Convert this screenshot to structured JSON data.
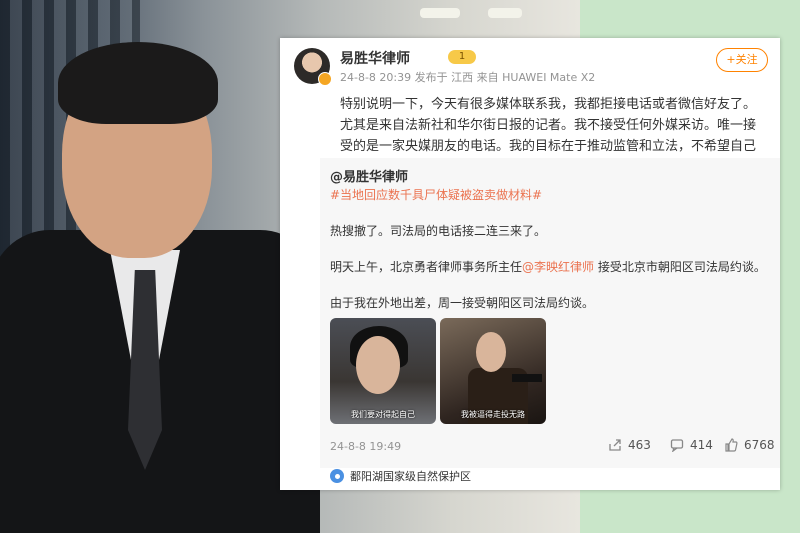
{
  "post": {
    "author": "易胜华律师",
    "level_badge": "1",
    "meta": "24-8-8 20:39 发布于 江西 来自 HUAWEI Mate X2",
    "follow_label": "+关注",
    "text": "特别说明一下，今天有很多媒体联系我，我都拒接电话或者微信好友了。尤其是来自法新社和华尔街日报的记者。我不接受任何外媒采访。唯一接受的是一家央媒朋友的电话。我的目标在于推动监管和立法，不希望自己未来死无全尸！"
  },
  "repost": {
    "author": "@易胜华律师",
    "hashtag": "#当地回应数千具尸体疑被盗卖做材料#",
    "line1": "热搜撤了。司法局的电话接二连三来了。",
    "line2_pre": "明天上午，北京勇者律师事务所主任",
    "line2_mention": "@李映红律师",
    "line2_post": " 接受北京市朝阳区司法局约谈。",
    "line3": "由于我在外地出差，周一接受朝阳区司法局约谈。",
    "image1_caption": "我们要对得起自己",
    "image2_caption": "我被逼得走投无路",
    "time": "24-8-8 19:49",
    "shares": "463",
    "comments": "414",
    "likes": "6768"
  },
  "location": "鄱阳湖国家级自然保护区",
  "colors": {
    "accent": "#ff8200",
    "link": "#eb7350",
    "background": "#c9e6c9"
  }
}
